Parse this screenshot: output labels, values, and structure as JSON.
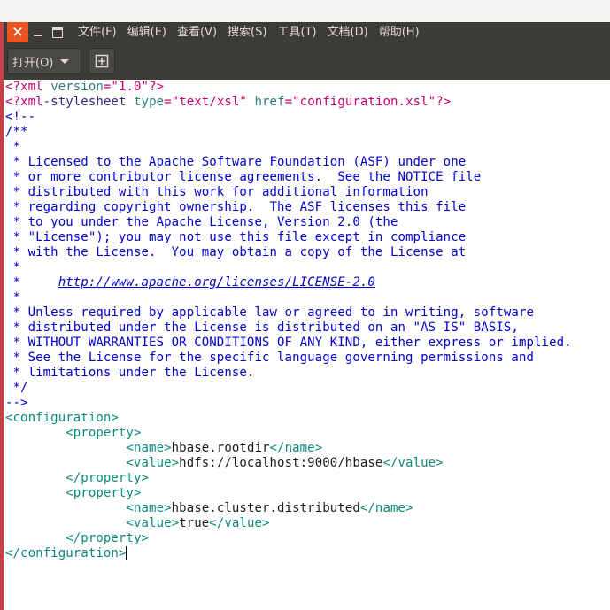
{
  "window": {
    "menus": [
      "文件(F)",
      "编辑(E)",
      "查看(V)",
      "搜索(S)",
      "工具(T)",
      "文档(D)",
      "帮助(H)"
    ]
  },
  "toolbar": {
    "open_label": "打开(O)"
  },
  "editor": {
    "lines": [
      [
        [
          "pi",
          "<?xml "
        ],
        [
          "attr",
          "version"
        ],
        [
          "pi",
          "="
        ],
        [
          "str",
          "\"1.0\""
        ],
        [
          "pi",
          "?>"
        ]
      ],
      [
        [
          "pi",
          "<?xml"
        ],
        [
          "pi-n",
          "-stylesheet "
        ],
        [
          "attr",
          "type"
        ],
        [
          "pi",
          "="
        ],
        [
          "str",
          "\"text/xsl\""
        ],
        [
          "pi",
          " "
        ],
        [
          "attr",
          "href"
        ],
        [
          "pi",
          "="
        ],
        [
          "str",
          "\"configuration.xsl\""
        ],
        [
          "pi",
          "?>"
        ]
      ],
      [
        [
          "cm",
          "<!--"
        ]
      ],
      [
        [
          "cm",
          "/**"
        ]
      ],
      [
        [
          "cm",
          " *"
        ]
      ],
      [
        [
          "cm",
          " * Licensed to the Apache Software Foundation (ASF) under one"
        ]
      ],
      [
        [
          "cm",
          " * or more contributor license agreements.  See the NOTICE file"
        ]
      ],
      [
        [
          "cm",
          " * distributed with this work for additional information"
        ]
      ],
      [
        [
          "cm",
          " * regarding copyright ownership.  The ASF licenses this file"
        ]
      ],
      [
        [
          "cm",
          " * to you under the Apache License, Version 2.0 (the"
        ]
      ],
      [
        [
          "cm",
          " * \"License\"); you may not use this file except in compliance"
        ]
      ],
      [
        [
          "cm",
          " * with the License.  You may obtain a copy of the License at"
        ]
      ],
      [
        [
          "cm",
          " *"
        ]
      ],
      [
        [
          "cm",
          " *     "
        ],
        [
          "url",
          "http://www.apache.org/licenses/LICENSE-2.0"
        ]
      ],
      [
        [
          "cm",
          " *"
        ]
      ],
      [
        [
          "cm",
          " * Unless required by applicable law or agreed to in writing, software"
        ]
      ],
      [
        [
          "cm",
          " * distributed under the License is distributed on an \"AS IS\" BASIS,"
        ]
      ],
      [
        [
          "cm",
          " * WITHOUT WARRANTIES OR CONDITIONS OF ANY KIND, either express or implied."
        ]
      ],
      [
        [
          "cm",
          " * See the License for the specific language governing permissions and"
        ]
      ],
      [
        [
          "cm",
          " * limitations under the License."
        ]
      ],
      [
        [
          "cm",
          " */"
        ]
      ],
      [
        [
          "cm",
          "-->"
        ]
      ],
      [
        [
          "tag",
          "<configuration>"
        ]
      ],
      [
        [
          "txt",
          "        "
        ],
        [
          "tag",
          "<property>"
        ]
      ],
      [
        [
          "txt",
          "                "
        ],
        [
          "tag",
          "<name>"
        ],
        [
          "txt",
          "hbase.rootdir"
        ],
        [
          "tag",
          "</name>"
        ]
      ],
      [
        [
          "txt",
          "                "
        ],
        [
          "tag",
          "<value>"
        ],
        [
          "txt",
          "hdfs://localhost:9000/hbase"
        ],
        [
          "tag",
          "</value>"
        ]
      ],
      [
        [
          "txt",
          "        "
        ],
        [
          "tag",
          "</property>"
        ]
      ],
      [
        [
          "txt",
          "        "
        ],
        [
          "tag",
          "<property>"
        ]
      ],
      [
        [
          "txt",
          "                "
        ],
        [
          "tag",
          "<name>"
        ],
        [
          "txt",
          "hbase.cluster.distributed"
        ],
        [
          "tag",
          "</name>"
        ]
      ],
      [
        [
          "txt",
          "                "
        ],
        [
          "tag",
          "<value>"
        ],
        [
          "txt",
          "true"
        ],
        [
          "tag",
          "</value>"
        ]
      ],
      [
        [
          "txt",
          "        "
        ],
        [
          "tag",
          "</property>"
        ]
      ],
      [
        [
          "tag",
          "</configuration>"
        ]
      ]
    ]
  }
}
